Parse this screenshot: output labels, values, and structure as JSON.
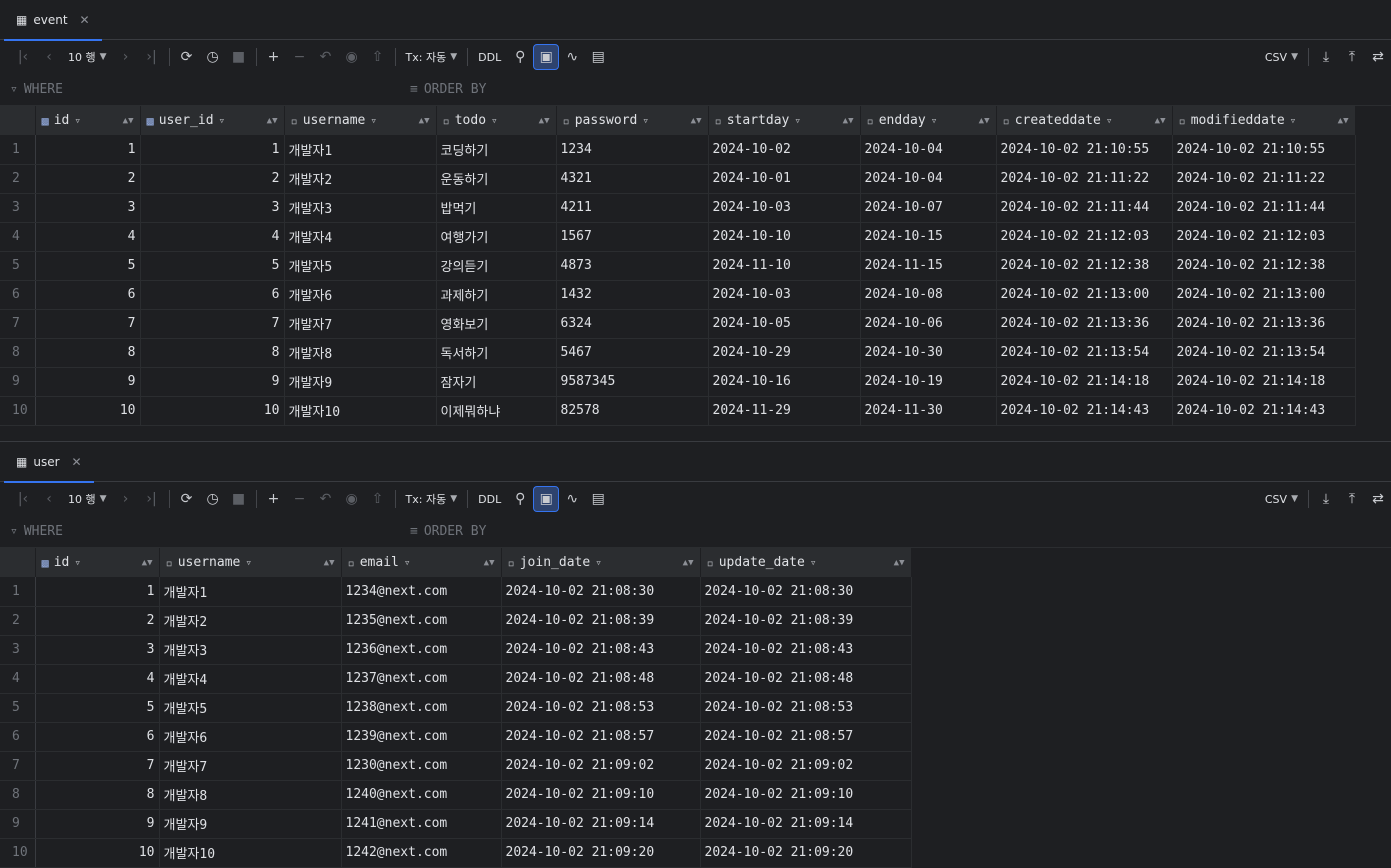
{
  "event": {
    "tab_title": "event",
    "toolbar": {
      "rows_label": "10 행",
      "tx_label": "Tx: 자동",
      "ddl_label": "DDL",
      "export_label": "CSV"
    },
    "filter": {
      "where": "WHERE",
      "order_by": "ORDER BY"
    },
    "columns": [
      "id",
      "user_id",
      "username",
      "todo",
      "password",
      "startday",
      "endday",
      "createddate",
      "modifieddate"
    ],
    "rows": [
      [
        "1",
        "1",
        "1",
        "개발자1",
        "코딩하기",
        "1234",
        "2024-10-02",
        "2024-10-04",
        "2024-10-02 21:10:55",
        "2024-10-02 21:10:55"
      ],
      [
        "2",
        "2",
        "2",
        "개발자2",
        "운동하기",
        "4321",
        "2024-10-01",
        "2024-10-04",
        "2024-10-02 21:11:22",
        "2024-10-02 21:11:22"
      ],
      [
        "3",
        "3",
        "3",
        "개발자3",
        "밥먹기",
        "4211",
        "2024-10-03",
        "2024-10-07",
        "2024-10-02 21:11:44",
        "2024-10-02 21:11:44"
      ],
      [
        "4",
        "4",
        "4",
        "개발자4",
        "여행가기",
        "1567",
        "2024-10-10",
        "2024-10-15",
        "2024-10-02 21:12:03",
        "2024-10-02 21:12:03"
      ],
      [
        "5",
        "5",
        "5",
        "개발자5",
        "강의듣기",
        "4873",
        "2024-11-10",
        "2024-11-15",
        "2024-10-02 21:12:38",
        "2024-10-02 21:12:38"
      ],
      [
        "6",
        "6",
        "6",
        "개발자6",
        "과제하기",
        "1432",
        "2024-10-03",
        "2024-10-08",
        "2024-10-02 21:13:00",
        "2024-10-02 21:13:00"
      ],
      [
        "7",
        "7",
        "7",
        "개발자7",
        "영화보기",
        "6324",
        "2024-10-05",
        "2024-10-06",
        "2024-10-02 21:13:36",
        "2024-10-02 21:13:36"
      ],
      [
        "8",
        "8",
        "8",
        "개발자8",
        "독서하기",
        "5467",
        "2024-10-29",
        "2024-10-30",
        "2024-10-02 21:13:54",
        "2024-10-02 21:13:54"
      ],
      [
        "9",
        "9",
        "9",
        "개발자9",
        "잠자기",
        "9587345",
        "2024-10-16",
        "2024-10-19",
        "2024-10-02 21:14:18",
        "2024-10-02 21:14:18"
      ],
      [
        "10",
        "10",
        "10",
        "개발자10",
        "이제뭐하냐",
        "82578",
        "2024-11-29",
        "2024-11-30",
        "2024-10-02 21:14:43",
        "2024-10-02 21:14:43"
      ]
    ]
  },
  "user": {
    "tab_title": "user",
    "toolbar": {
      "rows_label": "10 행",
      "tx_label": "Tx: 자동",
      "ddl_label": "DDL",
      "export_label": "CSV"
    },
    "filter": {
      "where": "WHERE",
      "order_by": "ORDER BY"
    },
    "columns": [
      "id",
      "username",
      "email",
      "join_date",
      "update_date"
    ],
    "rows": [
      [
        "1",
        "1",
        "개발자1",
        "1234@next.com",
        "2024-10-02 21:08:30",
        "2024-10-02 21:08:30"
      ],
      [
        "2",
        "2",
        "개발자2",
        "1235@next.com",
        "2024-10-02 21:08:39",
        "2024-10-02 21:08:39"
      ],
      [
        "3",
        "3",
        "개발자3",
        "1236@next.com",
        "2024-10-02 21:08:43",
        "2024-10-02 21:08:43"
      ],
      [
        "4",
        "4",
        "개발자4",
        "1237@next.com",
        "2024-10-02 21:08:48",
        "2024-10-02 21:08:48"
      ],
      [
        "5",
        "5",
        "개발자5",
        "1238@next.com",
        "2024-10-02 21:08:53",
        "2024-10-02 21:08:53"
      ],
      [
        "6",
        "6",
        "개발자6",
        "1239@next.com",
        "2024-10-02 21:08:57",
        "2024-10-02 21:08:57"
      ],
      [
        "7",
        "7",
        "개발자7",
        "1230@next.com",
        "2024-10-02 21:09:02",
        "2024-10-02 21:09:02"
      ],
      [
        "8",
        "8",
        "개발자8",
        "1240@next.com",
        "2024-10-02 21:09:10",
        "2024-10-02 21:09:10"
      ],
      [
        "9",
        "9",
        "개발자9",
        "1241@next.com",
        "2024-10-02 21:09:14",
        "2024-10-02 21:09:14"
      ],
      [
        "10",
        "10",
        "개발자10",
        "1242@next.com",
        "2024-10-02 21:09:20",
        "2024-10-02 21:09:20"
      ]
    ]
  }
}
